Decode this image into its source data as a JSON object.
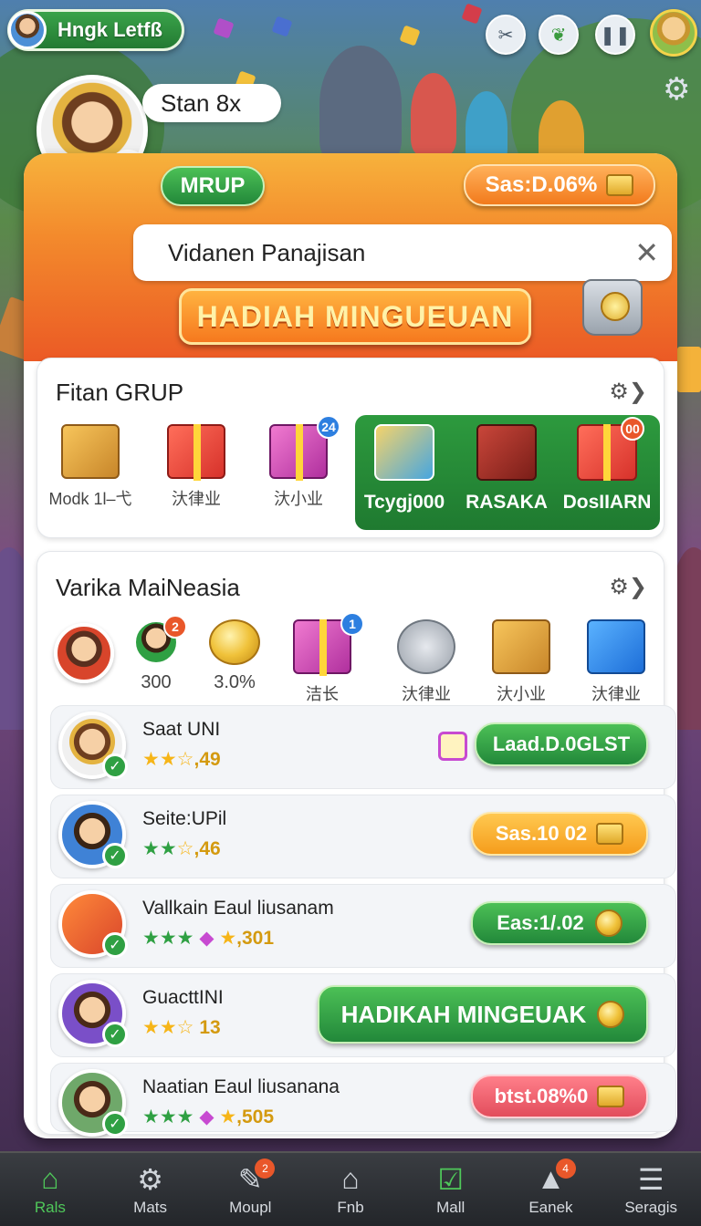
{
  "top": {
    "player_name": "Hngk Letfß",
    "profile_name": "Stan 8x"
  },
  "card": {
    "tag_label": "MRUP",
    "balance_label": "Sas:D.06%",
    "search_text": "Vidanen Panajisan",
    "banner_label": "HADIAH MINGUEUAN"
  },
  "section1": {
    "title": "Fitan GRUP",
    "rewards": [
      {
        "label": "Modk 1l–弋"
      },
      {
        "label": "汏律业"
      },
      {
        "label": "汏小业",
        "badge": "24"
      }
    ],
    "panel_items": [
      {
        "label": "Tcygj000"
      },
      {
        "label": "RASAKA"
      },
      {
        "label": "DosIIARN",
        "badge": "00"
      }
    ]
  },
  "section2": {
    "title": "Varika MaiNeasia",
    "rewards": [
      {
        "label": "300",
        "badge": "2"
      },
      {
        "label": "3.0%"
      },
      {
        "label": "洁长",
        "badge": "1"
      },
      {
        "label": "汏律业"
      },
      {
        "label": "汏小业"
      },
      {
        "label": "汏律业"
      }
    ]
  },
  "rows": [
    {
      "name": "Saat UNI",
      "rating": ",49",
      "button": "Laad.D.0GLST"
    },
    {
      "name": "Seite:UPil",
      "rating": ",46",
      "button": "Sas.10 02"
    },
    {
      "name": "Vallkain Eaul liusanam",
      "rating": ",301",
      "button": "Eas:1/.02"
    },
    {
      "name": "GuacttINI",
      "rating": "13",
      "button": "HADIKAH MINGEUAK"
    },
    {
      "name": "Naatian Eaul liusanana",
      "rating": ",505",
      "button": "btst.08%0"
    }
  ],
  "nav": [
    {
      "label": "Rals",
      "icon": "home-icon"
    },
    {
      "label": "Mats",
      "icon": "gear-icon"
    },
    {
      "label": "Moupl",
      "icon": "tag-icon",
      "badge": "2"
    },
    {
      "label": "Fnb",
      "icon": "door-icon"
    },
    {
      "label": "Mall",
      "icon": "check-icon"
    },
    {
      "label": "Eanek",
      "icon": "tent-icon",
      "badge": "4"
    },
    {
      "label": "Seragis",
      "icon": "menu-icon"
    }
  ],
  "colors": {
    "accent_green": "#2fa043",
    "header_orange": "#f38a2c",
    "nav_bg": "#2a2d31"
  }
}
